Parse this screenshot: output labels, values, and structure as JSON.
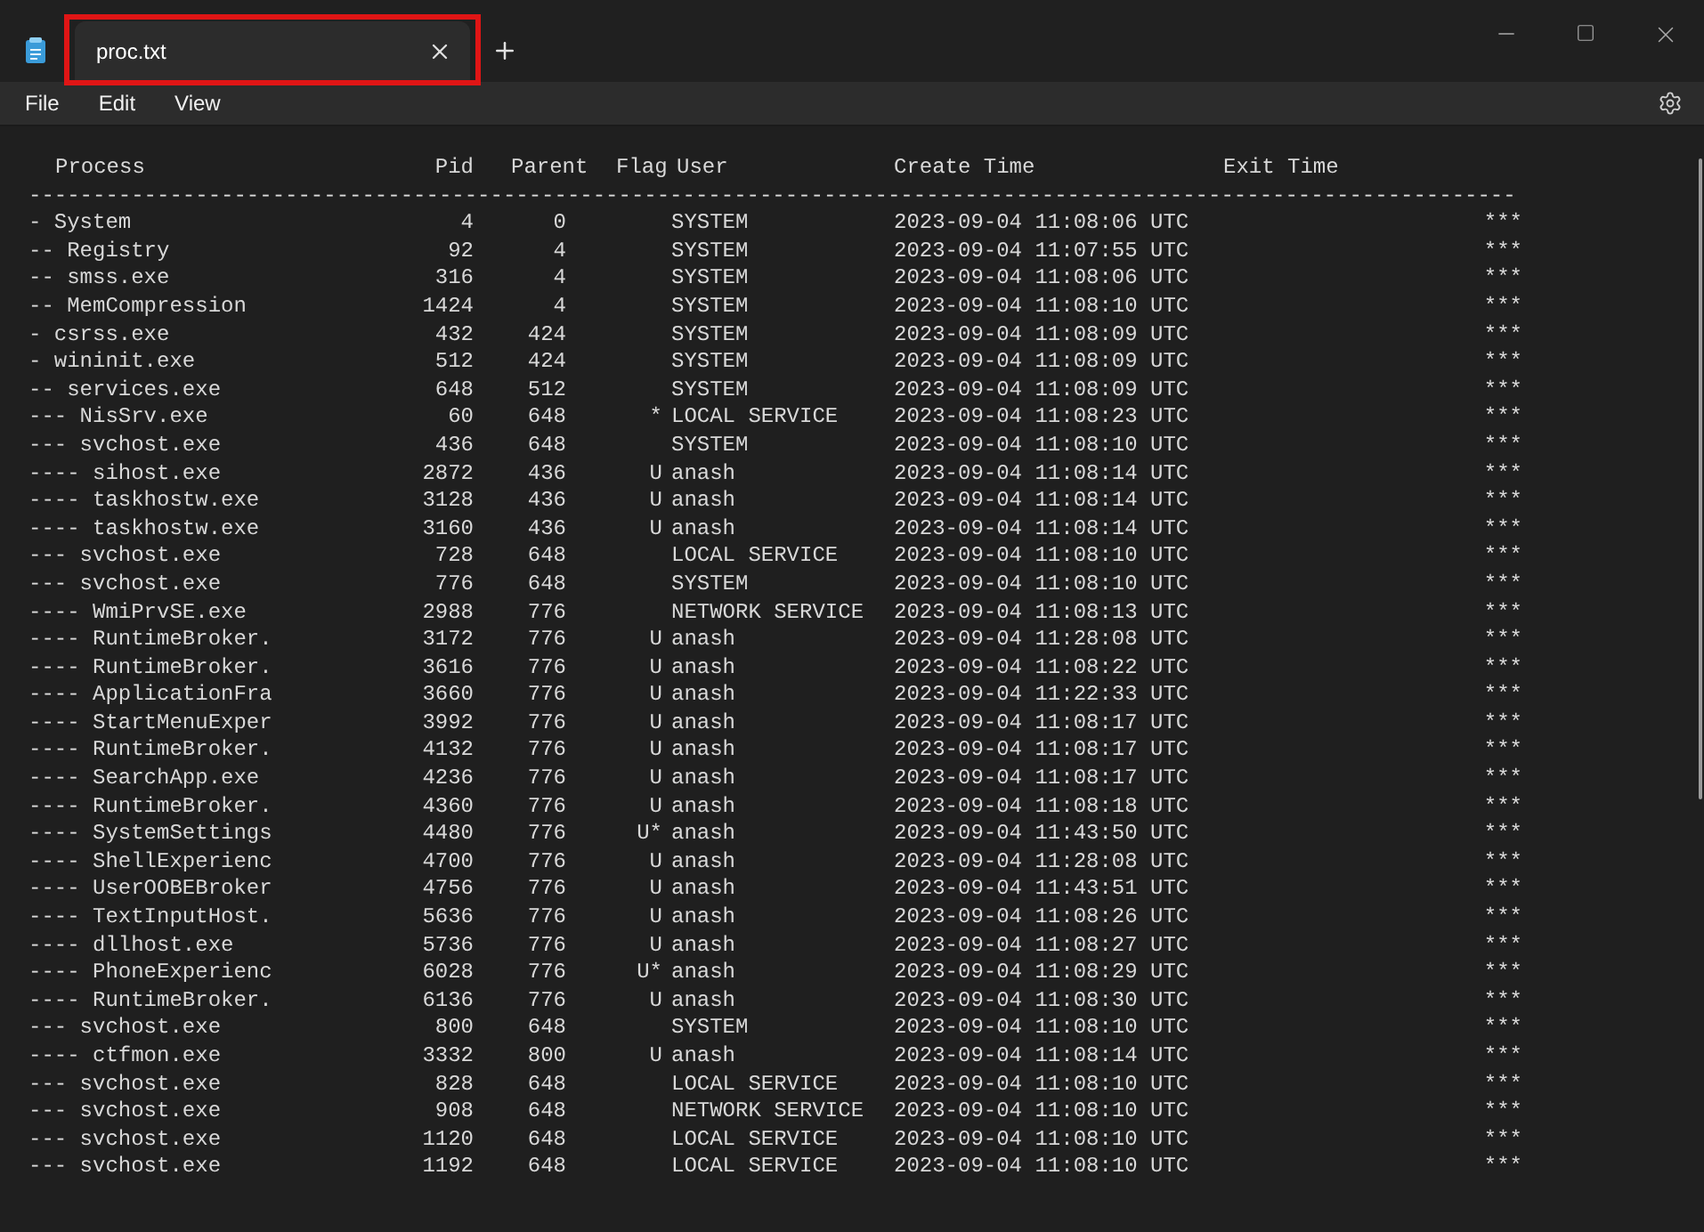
{
  "tab": {
    "title": "proc.txt",
    "selected": true
  },
  "menu": [
    {
      "label": "File"
    },
    {
      "label": "Edit"
    },
    {
      "label": "View"
    }
  ],
  "document": {
    "header": {
      "process": "Process",
      "pid": "Pid",
      "parent": "Parent",
      "flag": "Flag",
      "user": "User",
      "created": "Create Time",
      "exited": "Exit Time"
    },
    "separator": "--------------------------------------------------------------------------------------------------------------------",
    "rows": [
      {
        "process": "- System",
        "pid": "4",
        "parent": "0",
        "user": "SYSTEM",
        "created": "2023-09-04 11:08:06 UTC",
        "exited": "***"
      },
      {
        "process": "-- Registry",
        "pid": "92",
        "parent": "4",
        "user": "SYSTEM",
        "created": "2023-09-04 11:07:55 UTC",
        "exited": "***"
      },
      {
        "process": "-- smss.exe",
        "pid": "316",
        "parent": "4",
        "user": "SYSTEM",
        "created": "2023-09-04 11:08:06 UTC",
        "exited": "***"
      },
      {
        "process": "-- MemCompression",
        "pid": "1424",
        "parent": "4",
        "user": "SYSTEM",
        "created": "2023-09-04 11:08:10 UTC",
        "exited": "***"
      },
      {
        "process": "- csrss.exe",
        "pid": "432",
        "parent": "424",
        "user": "SYSTEM",
        "created": "2023-09-04 11:08:09 UTC",
        "exited": "***"
      },
      {
        "process": "- wininit.exe",
        "pid": "512",
        "parent": "424",
        "user": "SYSTEM",
        "created": "2023-09-04 11:08:09 UTC",
        "exited": "***"
      },
      {
        "process": "-- services.exe",
        "pid": "648",
        "parent": "512",
        "user": "SYSTEM",
        "created": "2023-09-04 11:08:09 UTC",
        "exited": "***"
      },
      {
        "process": "--- NisSrv.exe",
        "pid": "60",
        "parent": "648",
        "flag": "*",
        "user": "LOCAL SERVICE",
        "created": "2023-09-04 11:08:23 UTC",
        "exited": "***"
      },
      {
        "process": "--- svchost.exe",
        "pid": "436",
        "parent": "648",
        "user": "SYSTEM",
        "created": "2023-09-04 11:08:10 UTC",
        "exited": "***"
      },
      {
        "process": "---- sihost.exe",
        "pid": "2872",
        "parent": "436",
        "flag": "U",
        "user": "anash",
        "created": "2023-09-04 11:08:14 UTC",
        "exited": "***"
      },
      {
        "process": "---- taskhostw.exe",
        "pid": "3128",
        "parent": "436",
        "flag": "U",
        "user": "anash",
        "created": "2023-09-04 11:08:14 UTC",
        "exited": "***"
      },
      {
        "process": "---- taskhostw.exe",
        "pid": "3160",
        "parent": "436",
        "flag": "U",
        "user": "anash",
        "created": "2023-09-04 11:08:14 UTC",
        "exited": "***"
      },
      {
        "process": "--- svchost.exe",
        "pid": "728",
        "parent": "648",
        "user": "LOCAL SERVICE",
        "created": "2023-09-04 11:08:10 UTC",
        "exited": "***"
      },
      {
        "process": "--- svchost.exe",
        "pid": "776",
        "parent": "648",
        "user": "SYSTEM",
        "created": "2023-09-04 11:08:10 UTC",
        "exited": "***"
      },
      {
        "process": "---- WmiPrvSE.exe",
        "pid": "2988",
        "parent": "776",
        "user": "NETWORK SERVICE",
        "created": "2023-09-04 11:08:13 UTC",
        "exited": "***"
      },
      {
        "process": "---- RuntimeBroker.",
        "pid": "3172",
        "parent": "776",
        "flag": "U",
        "user": "anash",
        "created": "2023-09-04 11:28:08 UTC",
        "exited": "***"
      },
      {
        "process": "---- RuntimeBroker.",
        "pid": "3616",
        "parent": "776",
        "flag": "U",
        "user": "anash",
        "created": "2023-09-04 11:08:22 UTC",
        "exited": "***"
      },
      {
        "process": "---- ApplicationFra",
        "pid": "3660",
        "parent": "776",
        "flag": "U",
        "user": "anash",
        "created": "2023-09-04 11:22:33 UTC",
        "exited": "***"
      },
      {
        "process": "---- StartMenuExper",
        "pid": "3992",
        "parent": "776",
        "flag": "U",
        "user": "anash",
        "created": "2023-09-04 11:08:17 UTC",
        "exited": "***"
      },
      {
        "process": "---- RuntimeBroker.",
        "pid": "4132",
        "parent": "776",
        "flag": "U",
        "user": "anash",
        "created": "2023-09-04 11:08:17 UTC",
        "exited": "***"
      },
      {
        "process": "---- SearchApp.exe",
        "pid": "4236",
        "parent": "776",
        "flag": "U",
        "user": "anash",
        "created": "2023-09-04 11:08:17 UTC",
        "exited": "***"
      },
      {
        "process": "---- RuntimeBroker.",
        "pid": "4360",
        "parent": "776",
        "flag": "U",
        "user": "anash",
        "created": "2023-09-04 11:08:18 UTC",
        "exited": "***"
      },
      {
        "process": "---- SystemSettings",
        "pid": "4480",
        "parent": "776",
        "flag": "U*",
        "user": "anash",
        "created": "2023-09-04 11:43:50 UTC",
        "exited": "***"
      },
      {
        "process": "---- ShellExperienc",
        "pid": "4700",
        "parent": "776",
        "flag": "U",
        "user": "anash",
        "created": "2023-09-04 11:28:08 UTC",
        "exited": "***"
      },
      {
        "process": "---- UserOOBEBroker",
        "pid": "4756",
        "parent": "776",
        "flag": "U",
        "user": "anash",
        "created": "2023-09-04 11:43:51 UTC",
        "exited": "***"
      },
      {
        "process": "---- TextInputHost.",
        "pid": "5636",
        "parent": "776",
        "flag": "U",
        "user": "anash",
        "created": "2023-09-04 11:08:26 UTC",
        "exited": "***"
      },
      {
        "process": "---- dllhost.exe",
        "pid": "5736",
        "parent": "776",
        "flag": "U",
        "user": "anash",
        "created": "2023-09-04 11:08:27 UTC",
        "exited": "***"
      },
      {
        "process": "---- PhoneExperienc",
        "pid": "6028",
        "parent": "776",
        "flag": "U*",
        "user": "anash",
        "created": "2023-09-04 11:08:29 UTC",
        "exited": "***"
      },
      {
        "process": "---- RuntimeBroker.",
        "pid": "6136",
        "parent": "776",
        "flag": "U",
        "user": "anash",
        "created": "2023-09-04 11:08:30 UTC",
        "exited": "***"
      },
      {
        "process": "--- svchost.exe",
        "pid": "800",
        "parent": "648",
        "user": "SYSTEM",
        "created": "2023-09-04 11:08:10 UTC",
        "exited": "***"
      },
      {
        "process": "---- ctfmon.exe",
        "pid": "3332",
        "parent": "800",
        "flag": "U",
        "user": "anash",
        "created": "2023-09-04 11:08:14 UTC",
        "exited": "***"
      },
      {
        "process": "--- svchost.exe",
        "pid": "828",
        "parent": "648",
        "user": "LOCAL SERVICE",
        "created": "2023-09-04 11:08:10 UTC",
        "exited": "***"
      },
      {
        "process": "--- svchost.exe",
        "pid": "908",
        "parent": "648",
        "user": "NETWORK SERVICE",
        "created": "2023-09-04 11:08:10 UTC",
        "exited": "***"
      },
      {
        "process": "--- svchost.exe",
        "pid": "1120",
        "parent": "648",
        "user": "LOCAL SERVICE",
        "created": "2023-09-04 11:08:10 UTC",
        "exited": "***"
      },
      {
        "process": "--- svchost.exe",
        "pid": "1192",
        "parent": "648",
        "user": "LOCAL SERVICE",
        "created": "2023-09-04 11:08:10 UTC",
        "exited": "***"
      }
    ]
  }
}
